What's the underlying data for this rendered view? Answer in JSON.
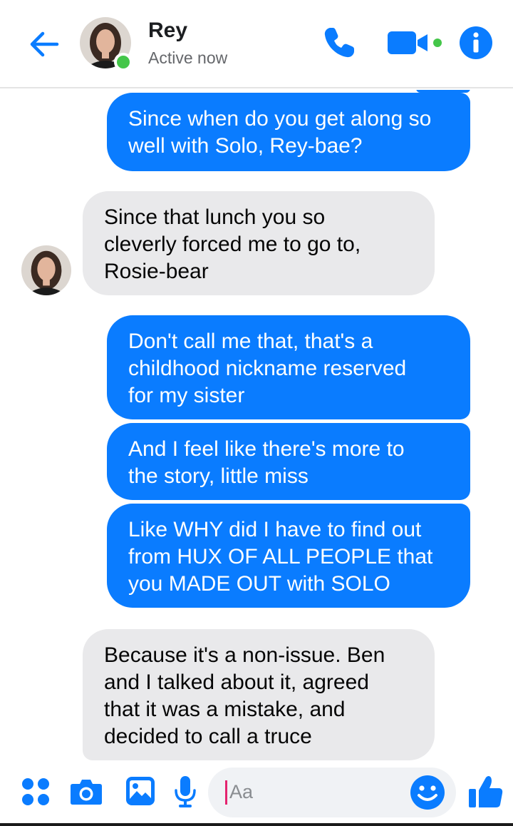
{
  "header": {
    "name": "Rey",
    "status": "Active now"
  },
  "messages": [
    {
      "side": "out",
      "text": "Since when do you get along so\nwell with Solo, Rey-bae?"
    },
    {
      "side": "in",
      "text": "Since that lunch you so\ncleverly forced me to go to,\nRosie-bear"
    },
    {
      "side": "out",
      "text": "Don't call me that, that's a\nchildhood nickname reserved\nfor my sister"
    },
    {
      "side": "out",
      "text": "And I feel like there's more to\nthe story, little miss"
    },
    {
      "side": "out",
      "text": "Like WHY did I have to find out\nfrom HUX OF ALL PEOPLE that\nyou MADE OUT with SOLO"
    },
    {
      "side": "in",
      "text": "Because it's a non-issue. Ben\nand I talked about it, agreed\nthat it was a mistake, and\ndecided to call a truce"
    }
  ],
  "composer": {
    "placeholder": "Aa"
  },
  "icons": {
    "header": [
      "back-arrow-icon",
      "phone-icon",
      "video-camera-icon",
      "info-icon"
    ],
    "composer": [
      "apps-icon",
      "camera-icon",
      "gallery-icon",
      "microphone-icon",
      "emoji-icon",
      "thumbs-up-icon"
    ]
  },
  "colors": {
    "accent": "#0a7cff",
    "incoming_bubble": "#e9e9eb",
    "online": "#44c649"
  }
}
